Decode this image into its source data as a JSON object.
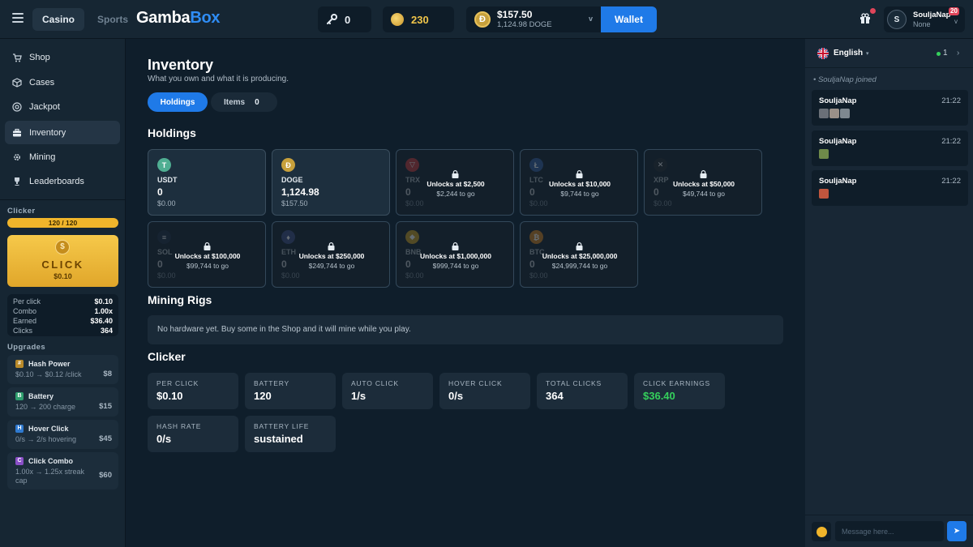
{
  "topbar": {
    "tabs": [
      {
        "label": "Casino",
        "active": true
      },
      {
        "label": "Sports",
        "active": false
      }
    ],
    "logo_part1": "Gamba",
    "logo_part2": "Box",
    "keys": "0",
    "coins": "230",
    "balance_usd": "$157.50",
    "balance_crypto": "1,124.98 DOGE",
    "wallet_label": "Wallet",
    "user": {
      "name": "SouljaNap",
      "status": "None",
      "initial": "S",
      "level": "20"
    }
  },
  "sidebar": {
    "nav": [
      {
        "label": "Shop",
        "icon": "cart-icon"
      },
      {
        "label": "Cases",
        "icon": "box-icon"
      },
      {
        "label": "Jackpot",
        "icon": "target-icon"
      },
      {
        "label": "Inventory",
        "icon": "briefcase-icon",
        "active": true
      },
      {
        "label": "Mining",
        "icon": "gear-icon"
      },
      {
        "label": "Leaderboards",
        "icon": "trophy-icon"
      }
    ],
    "clicker": {
      "title": "Clicker",
      "charge": "120 / 120",
      "button_label": "CLICK",
      "button_value": "$0.10",
      "stats": [
        {
          "label": "Per click",
          "value": "$0.10"
        },
        {
          "label": "Combo",
          "value": "1.00x"
        },
        {
          "label": "Earned",
          "value": "$36.40"
        },
        {
          "label": "Clicks",
          "value": "364"
        }
      ]
    },
    "upgrades_title": "Upgrades",
    "upgrades": [
      {
        "name": "Hash Power",
        "desc": "$0.10 → $0.12 /click",
        "price": "$8",
        "color": "#b98a2a"
      },
      {
        "name": "Battery",
        "desc": "120 → 200 charge",
        "price": "$15",
        "color": "#2f9e6e"
      },
      {
        "name": "Hover Click",
        "desc": "0/s → 2/s hovering",
        "price": "$45",
        "color": "#2f7ad0"
      },
      {
        "name": "Click Combo",
        "desc": "1.00x → 1.25x streak cap",
        "price": "$60",
        "color": "#8a4fc7"
      }
    ]
  },
  "main": {
    "title": "Inventory",
    "subtitle": "What you own and what it is producing.",
    "tabs": {
      "holdings": "Holdings",
      "items": "Items",
      "items_count": "0"
    },
    "holdings_title": "Holdings",
    "holdings": [
      {
        "symbol": "USDT",
        "amount": "0",
        "usd": "$0.00",
        "icon": "T",
        "color": "#4fae92",
        "locked": false
      },
      {
        "symbol": "DOGE",
        "amount": "1,124.98",
        "usd": "$157.50",
        "icon": "Ð",
        "color": "#c7a03b",
        "locked": false
      },
      {
        "symbol": "TRX",
        "amount": "0",
        "usd": "$0.00",
        "icon": "▽",
        "color": "#c43636",
        "locked": true,
        "unlock": "Unlocks at $2,500",
        "togo": "$2,244 to go"
      },
      {
        "symbol": "LTC",
        "amount": "0",
        "usd": "$0.00",
        "icon": "Ł",
        "color": "#345d9d",
        "locked": true,
        "unlock": "Unlocks at $10,000",
        "togo": "$9,744 to go"
      },
      {
        "symbol": "XRP",
        "amount": "0",
        "usd": "$0.00",
        "icon": "✕",
        "color": "#23292f",
        "locked": true,
        "unlock": "Unlocks at $50,000",
        "togo": "$49,744 to go"
      },
      {
        "symbol": "SOL",
        "amount": "0",
        "usd": "$0.00",
        "icon": "≡",
        "color": "#1d2b40",
        "locked": true,
        "unlock": "Unlocks at $100,000",
        "togo": "$99,744 to go"
      },
      {
        "symbol": "ETH",
        "amount": "0",
        "usd": "$0.00",
        "icon": "♦",
        "color": "#3c4a80",
        "locked": true,
        "unlock": "Unlocks at $250,000",
        "togo": "$249,744 to go"
      },
      {
        "symbol": "BNB",
        "amount": "0",
        "usd": "$0.00",
        "icon": "◆",
        "color": "#c99a1e",
        "locked": true,
        "unlock": "Unlocks at $1,000,000",
        "togo": "$999,744 to go"
      },
      {
        "symbol": "BTC",
        "amount": "0",
        "usd": "$0.00",
        "icon": "₿",
        "color": "#d07d1a",
        "locked": true,
        "unlock": "Unlocks at $25,000,000",
        "togo": "$24,999,744 to go"
      }
    ],
    "mining_title": "Mining Rigs",
    "mining_empty": "No hardware yet. Buy some in the Shop and it will mine while you play.",
    "clicker_title": "Clicker",
    "clicker_stats": [
      {
        "label": "PER CLICK",
        "value": "$0.10"
      },
      {
        "label": "BATTERY",
        "value": "120"
      },
      {
        "label": "AUTO CLICK",
        "value": "1/s"
      },
      {
        "label": "HOVER CLICK",
        "value": "0/s"
      },
      {
        "label": "TOTAL CLICKS",
        "value": "364"
      },
      {
        "label": "CLICK EARNINGS",
        "value": "$36.40",
        "highlight": true
      },
      {
        "label": "HASH RATE",
        "value": "0/s"
      },
      {
        "label": "BATTERY LIFE",
        "value": "sustained"
      }
    ]
  },
  "chat": {
    "language": "English",
    "online": "1",
    "joined_text": "SouljaNap joined",
    "messages": [
      {
        "user": "SouljaNap",
        "time": "21:22",
        "emotes": [
          "#6a7078",
          "#9a9088",
          "#7e8890"
        ]
      },
      {
        "user": "SouljaNap",
        "time": "21:22",
        "emotes": [
          "#6f8a4a"
        ]
      },
      {
        "user": "SouljaNap",
        "time": "21:22",
        "emotes": [
          "#c0563e"
        ]
      }
    ],
    "input_placeholder": "Message here..."
  }
}
